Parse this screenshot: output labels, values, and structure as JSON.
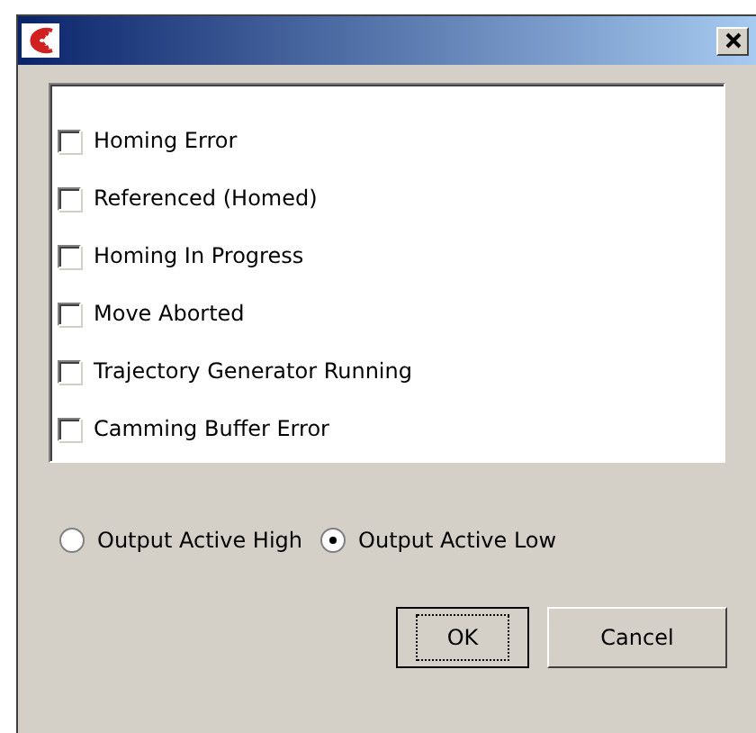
{
  "options": [
    {
      "label": "Homing Error",
      "checked": false
    },
    {
      "label": "Referenced (Homed)",
      "checked": false
    },
    {
      "label": "Homing In Progress",
      "checked": false
    },
    {
      "label": "Move Aborted",
      "checked": false
    },
    {
      "label": "Trajectory Generator Running",
      "checked": false
    },
    {
      "label": "Camming Buffer Error",
      "checked": false
    }
  ],
  "output_mode": [
    {
      "label": "Output Active High",
      "selected": false
    },
    {
      "label": "Output Active Low",
      "selected": true
    }
  ],
  "buttons": [
    {
      "label": "OK",
      "focused": true
    },
    {
      "label": "Cancel",
      "focused": false
    }
  ]
}
